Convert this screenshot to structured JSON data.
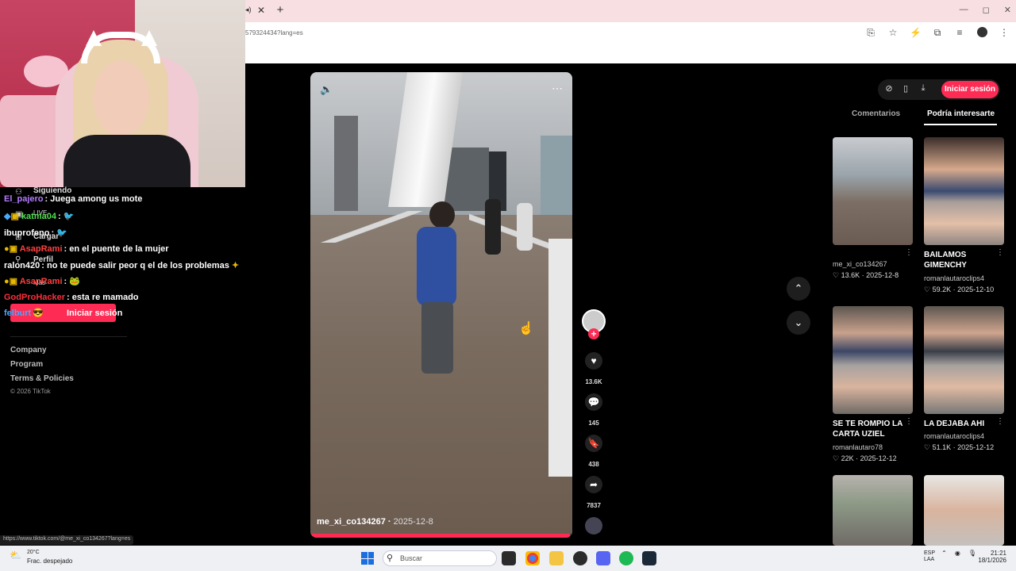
{
  "browser": {
    "tab_icon": "◂)",
    "tab_close": "✕",
    "tab_new": "+",
    "url": "579324434?lang=es",
    "window_controls": [
      "—",
      "◻",
      "✕"
    ]
  },
  "sidebar": {
    "items": [
      {
        "label": "Siguiendo",
        "icon": "user-icon"
      },
      {
        "label": "LIVE",
        "icon": "live-icon"
      },
      {
        "label": "Cargar",
        "icon": "upload-icon"
      },
      {
        "label": "Perfil",
        "icon": "profile-icon"
      },
      {
        "label": "Más",
        "icon": "more-icon"
      }
    ],
    "login_label": "Iniciar sesión",
    "footer": [
      "Company",
      "Program",
      "Terms & Policies"
    ],
    "copyright": "© 2026 TikTok"
  },
  "chat": [
    {
      "user": "El_pajero",
      "color": "#b57cff",
      "msg": "Juega among us mote"
    },
    {
      "user": "katma04",
      "color": "#50e050",
      "msg": ""
    },
    {
      "user": "ibuprofeno",
      "color": "#ffffff",
      "msg": ""
    },
    {
      "user": "AsapRami",
      "color": "#ff4040",
      "msg": "en el puente de la mujer"
    },
    {
      "user": "ralon420",
      "color": "#ffffff",
      "msg": "no te puede salir peor q el de los problemas"
    },
    {
      "user": "AsapRami",
      "color": "#ff4040",
      "msg": ""
    },
    {
      "user": "GodProHacker",
      "color": "#ff2e3b",
      "msg": "esta re mamado"
    },
    {
      "user": "felburt",
      "color": "#4aa8ff",
      "msg": ""
    }
  ],
  "video": {
    "author": "me_xi_co134267",
    "date": "2025-12-8",
    "progress": 0.99
  },
  "actions": {
    "likes": "13.6K",
    "comments": "145",
    "saves": "438",
    "shares": "7837"
  },
  "right_panel": {
    "login": "Iniciar sesión",
    "tabs": [
      "Comentarios",
      "Podría interesarte"
    ],
    "cards": [
      {
        "title": "",
        "user": "me_xi_co134267",
        "likes": "13.6K",
        "date": "2025-12-8"
      },
      {
        "title": "BAILAMOS GIMENCHY",
        "user": "romanlautaroclips4",
        "likes": "59.2K",
        "date": "2025-12-10"
      },
      {
        "title": "SE TE ROMPIO LA CARTA UZIEL",
        "user": "romanlautaro78",
        "likes": "22K",
        "date": "2025-12-12"
      },
      {
        "title": "LA DEJABA AHI",
        "user": "romanlautaroclips4",
        "likes": "51.1K",
        "date": "2025-12-12"
      }
    ]
  },
  "status_url": "https://www.tiktok.com/@me_xi_co134267?lang=es",
  "taskbar": {
    "temp": "20°C",
    "weather": "Frac. despejado",
    "search": "Buscar",
    "lang_1": "ESP",
    "lang_2": "LAA",
    "time": "21:21",
    "date": "18/1/2026"
  },
  "colors": {
    "accent": "#fe2c55"
  }
}
